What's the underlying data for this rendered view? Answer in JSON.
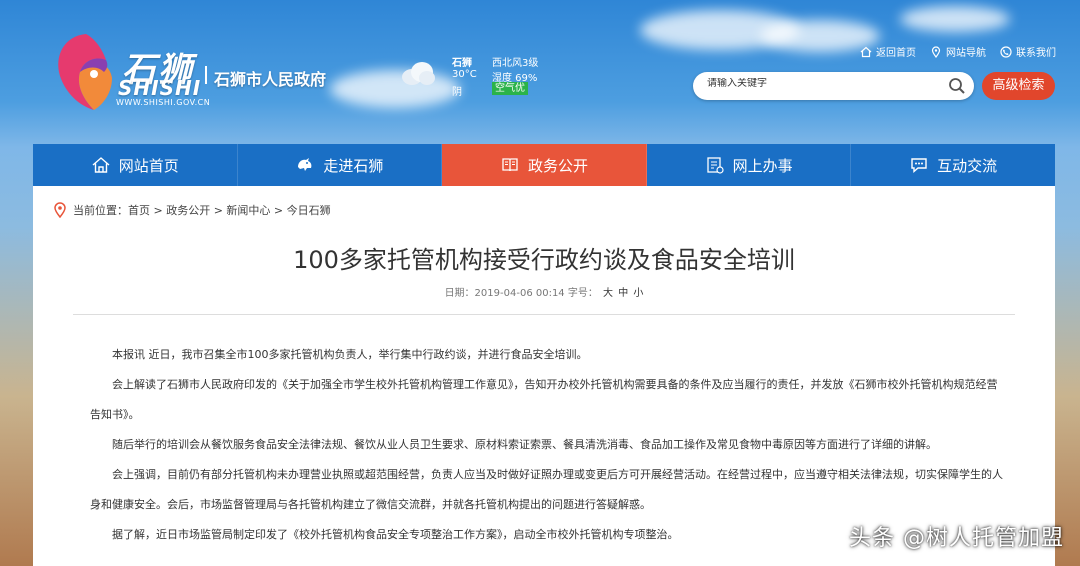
{
  "header": {
    "logo_cn": "石狮",
    "logo_en": "SHISHI",
    "logo_url": "WWW.SHISHI.GOV.CN",
    "gov_name": "石狮市人民政府"
  },
  "weather": {
    "city": "石狮",
    "temp": "30°C",
    "condition": "阴",
    "wind": "西北风3级",
    "humidity": "湿度 69%",
    "aqi": "空气优"
  },
  "toplinks": [
    {
      "label": "返回首页",
      "icon": "home-icon"
    },
    {
      "label": "网站导航",
      "icon": "location-icon"
    },
    {
      "label": "联系我们",
      "icon": "phone-icon"
    }
  ],
  "search": {
    "placeholder": "请输入关键字",
    "advanced_label": "高级检索"
  },
  "nav": [
    {
      "label": "网站首页",
      "icon": "home-icon"
    },
    {
      "label": "走进石狮",
      "icon": "lion-icon"
    },
    {
      "label": "政务公开",
      "icon": "book-icon"
    },
    {
      "label": "网上办事",
      "icon": "document-icon"
    },
    {
      "label": "互动交流",
      "icon": "chat-icon"
    }
  ],
  "breadcrumb": "当前位置：首页 > 政务公开 > 新闻中心 > 今日石狮",
  "article": {
    "title": "100多家托管机构接受行政约谈及食品安全培训",
    "date": "日期：2019-04-06 00:14 字号：",
    "font_sizes": [
      "大",
      "中",
      "小"
    ],
    "paragraphs": [
      "本报讯 近日，我市召集全市100多家托管机构负责人，举行集中行政约谈，并进行食品安全培训。",
      "会上解读了石狮市人民政府印发的《关于加强全市学生校外托管机构管理工作意见》，告知开办校外托管机构需要具备的条件及应当履行的责任，并发放《石狮市校外托管机构规范经营告知书》。",
      "随后举行的培训会从餐饮服务食品安全法律法规、餐饮从业人员卫生要求、原材料索证索票、餐具清洗消毒、食品加工操作及常见食物中毒原因等方面进行了详细的讲解。",
      "会上强调，目前仍有部分托管机构未办理营业执照或超范围经营，负责人应当及时做好证照办理或变更后方可开展经营活动。在经营过程中，应当遵守相关法律法规，切实保障学生的人身和健康安全。会后，市场监督管理局与各托管机构建立了微信交流群，并就各托管机构提出的问题进行答疑解惑。",
      "据了解，近日市场监管局制定印发了《校外托管机构食品安全专项整治工作方案》，启动全市校外托管机构专项整治。"
    ]
  },
  "watermark": "头条 @树人托管加盟",
  "colors": {
    "nav_bg": "#1a6fc5",
    "nav_active": "#e8553a",
    "accent_red": "#e1462c",
    "aqi_green": "#2bb34a"
  }
}
